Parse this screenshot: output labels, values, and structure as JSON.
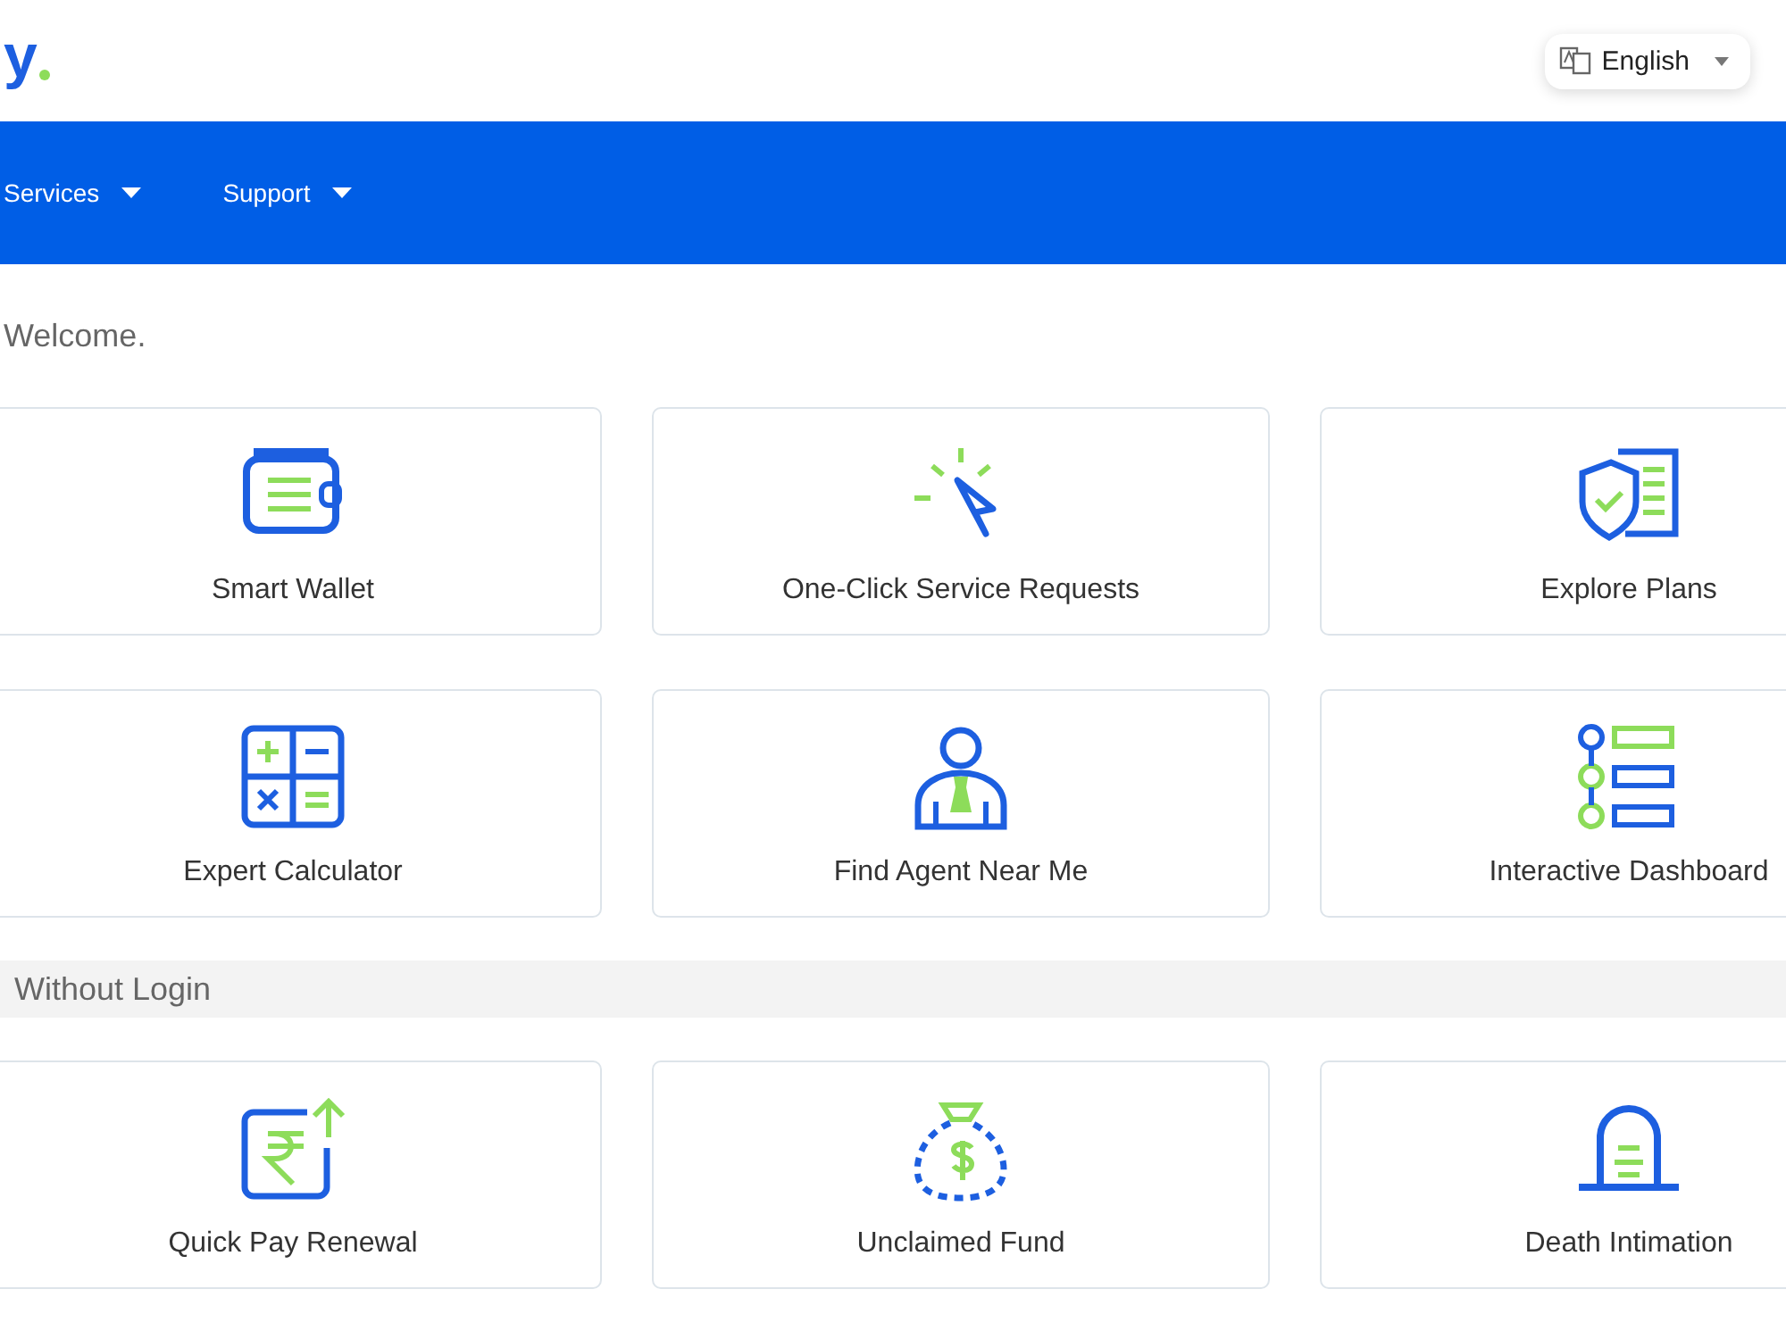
{
  "header": {
    "logo": "y",
    "language": "English"
  },
  "nav": [
    {
      "label": "Services"
    },
    {
      "label": "Support"
    }
  ],
  "welcome": "Welcome.",
  "sections": [
    {
      "cards": [
        {
          "label": "Smart Wallet"
        },
        {
          "label": "One-Click Service Requests"
        },
        {
          "label": "Explore Plans"
        },
        {
          "label": "Expert Calculator"
        },
        {
          "label": "Find Agent Near Me"
        },
        {
          "label": "Interactive Dashboard"
        }
      ]
    },
    {
      "title": "Without Login",
      "cards": [
        {
          "label": "Quick Pay Renewal"
        },
        {
          "label": "Unclaimed Fund"
        },
        {
          "label": "Death Intimation"
        }
      ]
    }
  ]
}
